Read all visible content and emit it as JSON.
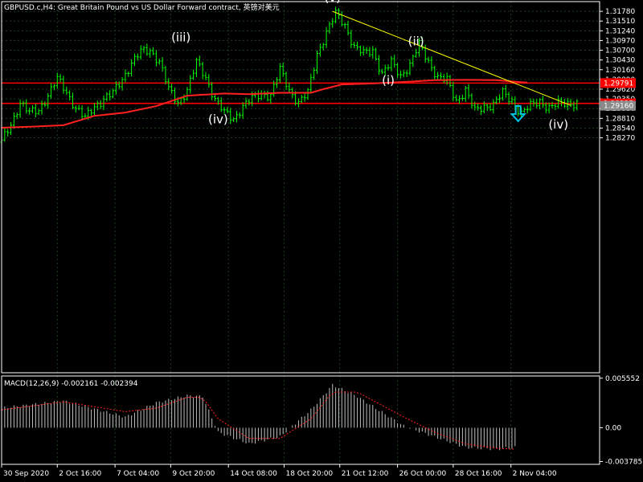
{
  "chart_data": [
    {
      "type": "candlestick",
      "title": "GBPUSD.c,H4:  Great Britain Pound vs US Dollar Forward contract, 英镑对美元",
      "ylim": [
        1.2175,
        1.3205
      ],
      "yticks": [
        "1.31780",
        "1.31510",
        "1.31240",
        "1.30970",
        "1.30700",
        "1.30430",
        "1.30160",
        "1.29890",
        "1.29620",
        "1.29350",
        "1.29080",
        "1.28810",
        "1.28540",
        "1.28270"
      ],
      "xticks": [
        "30 Sep 2020",
        "2 Oct 16:00",
        "7 Oct 04:00",
        "9 Oct 20:00",
        "14 Oct 08:00",
        "18 Oct 20:00",
        "21 Oct 12:00",
        "26 Oct 00:00",
        "28 Oct 16:00",
        "2 Nov 04:00"
      ],
      "price_marks": [
        {
          "value": 1.2979,
          "text": "1.29791"
        },
        {
          "value": 1.29225,
          "text": "1.29225"
        },
        {
          "value": 1.2916,
          "text": "1.29160"
        }
      ],
      "horizontal_lines": [
        1.2979,
        1.29225
      ],
      "grid": true,
      "series": [
        {
          "role": "price",
          "x": [
            0,
            3,
            6,
            9,
            12,
            15,
            18,
            21,
            24,
            27,
            30,
            33,
            36,
            39,
            42,
            45,
            48,
            51,
            54,
            57,
            60,
            63,
            66,
            69,
            72,
            75,
            78,
            81,
            84,
            87,
            90,
            93,
            96,
            99,
            102,
            105,
            108,
            111,
            114,
            117,
            120,
            123,
            126,
            129,
            132,
            135,
            138,
            141,
            144,
            147,
            150,
            153,
            156,
            159,
            162,
            165,
            168,
            171,
            174,
            177,
            180,
            183,
            186
          ],
          "close": [
            1.2815,
            1.2865,
            1.2925,
            1.2895,
            1.2905,
            1.2945,
            1.299,
            1.2955,
            1.291,
            1.288,
            1.2915,
            1.2935,
            1.295,
            1.299,
            1.3035,
            1.3065,
            1.307,
            1.304,
            1.296,
            1.2925,
            1.296,
            1.3035,
            1.2995,
            1.2935,
            1.2895,
            1.288,
            1.2915,
            1.2935,
            1.295,
            1.2945,
            1.3015,
            1.296,
            1.2925,
            1.295,
            1.306,
            1.312,
            1.317,
            1.314,
            1.308,
            1.306,
            1.307,
            1.3005,
            1.3035,
            1.3,
            1.303,
            1.3085,
            1.304,
            1.2995,
            1.2985,
            1.293,
            1.296,
            1.29,
            1.2915,
            1.292,
            1.295,
            1.293,
            1.2895,
            1.2915,
            1.293,
            1.291,
            1.292,
            1.2925,
            1.2922
          ]
        },
        {
          "role": "moving-average",
          "x": [
            0,
            10,
            20,
            30,
            40,
            50,
            60,
            66,
            72,
            80,
            90,
            100,
            104,
            110,
            120,
            130,
            140,
            150,
            160,
            170
          ],
          "values": [
            1.2855,
            1.2858,
            1.2862,
            1.2888,
            1.2897,
            1.2915,
            1.2944,
            1.2947,
            1.295,
            1.2948,
            1.2952,
            1.2952,
            1.2962,
            1.2975,
            1.2978,
            1.2982,
            1.2987,
            1.2988,
            1.2987,
            1.298
          ]
        }
      ],
      "trendline": {
        "x": [
          107,
          182
        ],
        "y": [
          1.3178,
          1.2917
        ]
      },
      "annotations": [
        {
          "text": "(v)",
          "x": 107,
          "y": 1.3205
        },
        {
          "text": "(iii)",
          "x": 58,
          "y": 1.3095
        },
        {
          "text": "(ii)",
          "x": 134,
          "y": 1.3084
        },
        {
          "text": "(i)",
          "x": 125,
          "y": 1.2975
        },
        {
          "text": "(iv)",
          "x": 70,
          "y": 1.2867
        },
        {
          "text": "(iv)",
          "x": 180,
          "y": 1.2853
        }
      ],
      "arrow": {
        "direction": "down",
        "x": 167,
        "y": 1.2893,
        "color": "#00c0e0"
      }
    },
    {
      "type": "bar",
      "title": "MACD(12,26,9) -0.002161 -0.002394",
      "ylim": [
        -0.0041,
        0.0058
      ],
      "yticks": [
        "0.005552",
        "0.00",
        "-0.003785"
      ],
      "series": [
        {
          "role": "histogram",
          "x": [
            0,
            20,
            40,
            50,
            60,
            65,
            70,
            80,
            90,
            100,
            107,
            115,
            130,
            140,
            150,
            160,
            166
          ],
          "values": [
            0.0022,
            0.003,
            0.0012,
            0.0028,
            0.0036,
            0.0035,
            -0.0005,
            -0.0018,
            -0.001,
            0.002,
            0.0048,
            0.0035,
            0.0002,
            -0.001,
            -0.0022,
            -0.0024,
            -0.0022
          ]
        },
        {
          "role": "signal",
          "x": [
            0,
            20,
            40,
            50,
            60,
            65,
            70,
            80,
            90,
            100,
            107,
            115,
            130,
            140,
            150,
            160,
            166
          ],
          "values": [
            0.002,
            0.0029,
            0.0018,
            0.0022,
            0.0034,
            0.0034,
            0.001,
            -0.0012,
            -0.0012,
            0.001,
            0.004,
            0.004,
            0.0012,
            -0.0005,
            -0.0018,
            -0.0023,
            -0.0024
          ]
        }
      ]
    }
  ],
  "colors": {
    "background": "#000000",
    "grid": "#1f3c1f",
    "candle": "#00ff00",
    "moving_average": "#ff2020",
    "horizontal_line": "#ff0000",
    "trendline": "#ffff00",
    "macd_histogram": "#bfbfbf",
    "signal": "#ff2020",
    "text": "#ffffff",
    "price_mark_bg": "#ff0000"
  }
}
